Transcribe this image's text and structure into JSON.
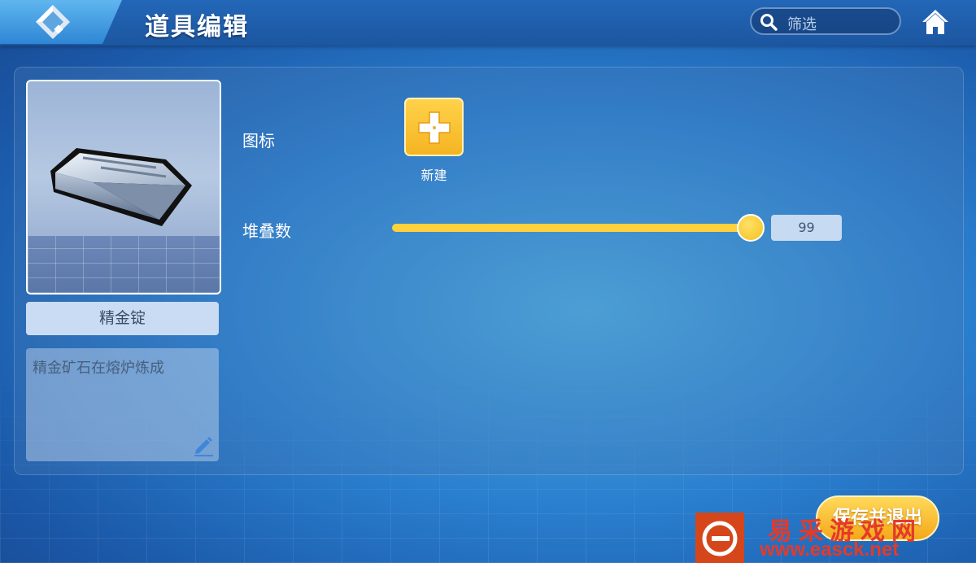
{
  "header": {
    "title": "道具编辑",
    "filter_placeholder": "筛选"
  },
  "item": {
    "name": "精金锭",
    "description": "精金矿石在熔炉炼成"
  },
  "icon_section": {
    "label": "图标",
    "new_button_label": "新建"
  },
  "stack_section": {
    "label": "堆叠数",
    "value": "99",
    "slider_fraction": 1.0
  },
  "footer": {
    "save_label": "保存并退出"
  },
  "watermark": {
    "name": "易采游戏网",
    "url": "www.easck.net"
  },
  "colors": {
    "accent_yellow": "#ffd23d",
    "panel_blue": "#2a7fcf",
    "watermark_red": "#e43a2a"
  }
}
